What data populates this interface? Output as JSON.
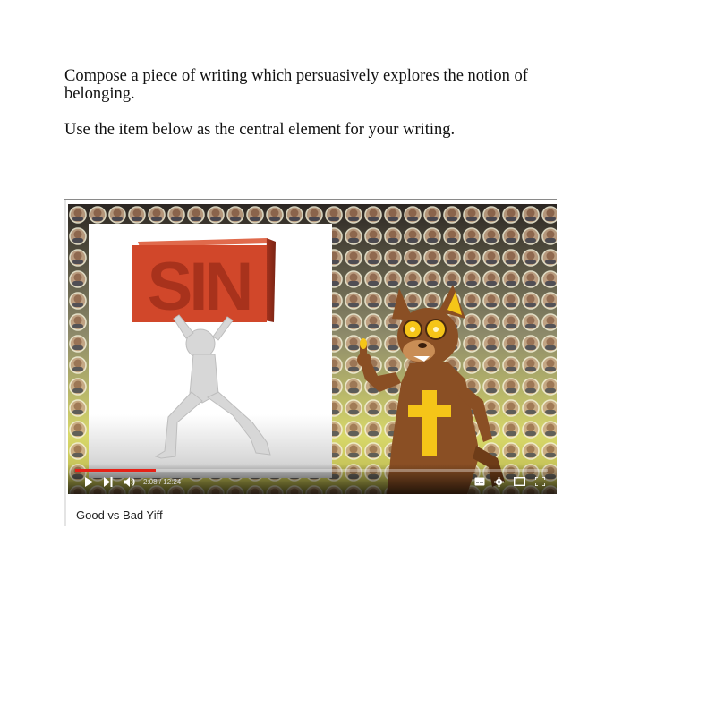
{
  "prompt": {
    "line1": "Compose a piece of writing which persuasively explores the notion of belonging.",
    "line2": "Use the item below as the central element for your writing."
  },
  "video": {
    "title": "Good vs Bad Yiff",
    "timecode": "2:08 / 12:24",
    "progress": 0.171,
    "thumbnail_text": "SIN",
    "controls": {
      "play_icon": "play-icon",
      "next_icon": "next-icon",
      "volume_icon": "volume-icon",
      "subtitles_icon": "subtitles-icon",
      "settings_icon": "gear-icon",
      "theater_icon": "theater-mode-icon",
      "fullscreen_icon": "fullscreen-icon"
    },
    "colors": {
      "progress": "#e62117",
      "sin_block": "#d1472a",
      "character_fur": "#8a4f24",
      "cross": "#f5c518"
    }
  }
}
